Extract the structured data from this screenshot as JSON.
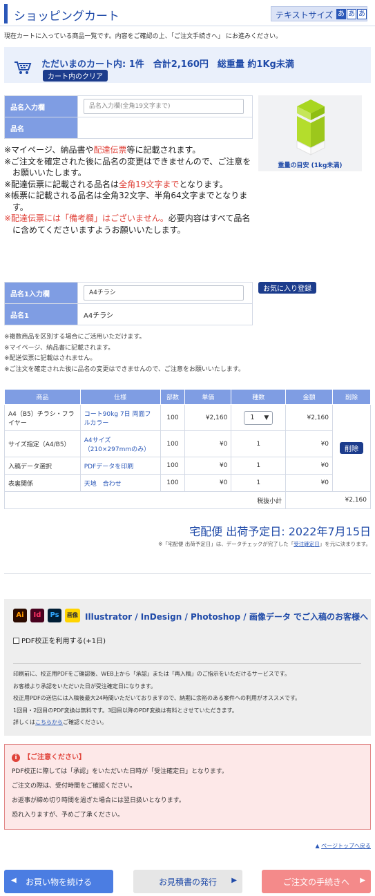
{
  "header": {
    "title": "ショッピングカート",
    "text_size_label": "テキストサイズ",
    "sizes": [
      "あ",
      "あ",
      "あ"
    ]
  },
  "intro": "現在カートに入っている商品一覧です。内容をご確認の上、「ご注文手続きへ」 にお進みください。",
  "cart_summary": {
    "text": "ただいまのカート内: 1件　合計2,160円　総重量 約1Kg未満",
    "clear_button": "カート内のクリア",
    "icon": "cart-icon"
  },
  "name_form": {
    "input_label": "品名入力欄",
    "input_placeholder": "品名入力欄(全角19文字まで)",
    "name_label": "品名",
    "name_value": ""
  },
  "weight": {
    "label": "重量の目安 (1kg未満)",
    "icon": "box-icon"
  },
  "notes1": {
    "l1a": "※マイページ、納品書や",
    "l1b": "配達伝票",
    "l1c": "等に記載されます。",
    "l2": "※ご注文を確定された後に品名の変更はできませんので、ご注意をお願いいたします。",
    "l3a": "※配達伝票に記載される品名は",
    "l3b": "全角19文字まで",
    "l3c": "となります。",
    "l4": "※帳票に記載される品名は全角32文字、半角64文字までとなります。",
    "l5a": "※配達伝票には「備考欄」はございません。",
    "l5b": "必要内容はすべて品名に含めてくださいますようお願いいたします。"
  },
  "item_form": {
    "input_label": "品名1入力欄",
    "input_value": "A4チラシ",
    "name_label": "品名1",
    "name_value": "A4チラシ",
    "favorite_button": "お気に入り登録"
  },
  "notes2": [
    "※複数商品を区別する場合にご活用いただけます。",
    "※マイページ、納品書に記載されます。",
    "※配送伝票に記載はされません。",
    "※ご注文を確定された後に品名の変更はできませんので、ご注意をお願いいたします。"
  ],
  "cart_table": {
    "headers": [
      "商品",
      "仕様",
      "部数",
      "単価",
      "種数",
      "金額",
      "削除"
    ],
    "rows": [
      {
        "product": "A4（B5）チラシ・フライヤー",
        "spec": "コート90kg 7日 両面フルカラー",
        "qty": "100",
        "unit": "¥2,160",
        "kinds": "1",
        "amount": "¥2,160"
      },
      {
        "product": "サイズ指定（A4/B5）",
        "spec": "A4サイズ（210×297mmのみ）",
        "qty": "100",
        "unit": "¥0",
        "kinds": "1",
        "amount": "¥0"
      },
      {
        "product": "入稿データ選択",
        "spec": "PDFデータを印刷",
        "qty": "100",
        "unit": "¥0",
        "kinds": "1",
        "amount": "¥0"
      },
      {
        "product": "表裏関係",
        "spec": "天地　合わせ",
        "qty": "100",
        "unit": "¥0",
        "kinds": "1",
        "amount": "¥0"
      }
    ],
    "delete_button": "削除",
    "subtotal_label": "税抜小計",
    "subtotal_value": "¥2,160"
  },
  "shipping": {
    "text": "宅配便 出荷予定日: 2022年7月15日",
    "note_a": "※「宅配便 出荷予定日」は、データチェックが完了した「",
    "note_link": "受注確定日",
    "note_b": "」を元に決まります。"
  },
  "pdf_section": {
    "app_icons": [
      {
        "name": "illustrator-icon",
        "text": "Ai",
        "bg": "#2b0b00",
        "fg": "#ff9a00"
      },
      {
        "name": "indesign-icon",
        "text": "Id",
        "bg": "#49021f",
        "fg": "#ff3366"
      },
      {
        "name": "photoshop-icon",
        "text": "Ps",
        "bg": "#001e36",
        "fg": "#31a8ff"
      },
      {
        "name": "image-icon",
        "text": "画像",
        "bg": "#ffd400",
        "fg": "#333333"
      }
    ],
    "heading": "Illustrator / InDesign / Photoshop / 画像データ でご入稿のお客様へ",
    "checkbox_label": "PDF校正を利用する(+1日)",
    "desc": [
      "印刷前に、校正用PDFをご确認後、WEB上から「承認」または「再入稿」のご指示をいただけるサービスです。",
      "お客様より承認をいただいた日が受注確定日になります。",
      "校正用PDFの送信には入稿後最大24時間いただいておりますので、納期に余裕のある案件への利用がオススメです。",
      "1回目・2回目のPDF変換は無料です。3回目以降のPDF変換は有料とさせていただきます。"
    ],
    "desc_last_a": "詳しくは",
    "desc_last_link": "こちらから",
    "desc_last_b": "ご確認ください。"
  },
  "warning": {
    "title": "【ご注意ください】",
    "lines": [
      "PDF校正に際しては「承認」をいただいた日時が「受注確定日」となります。",
      "ご注文の際は、受付時間をご確認ください。",
      "お返事が締め切り時間を過ぎた場合には翌日扱いとなります。",
      "恐れ入りますが、予めご了承ください。"
    ]
  },
  "page_top": "ページトップへ戻る",
  "buttons": {
    "back": "お買い物を続ける",
    "quote": "お見積書の発行",
    "order": "ご注文の手続きへ"
  }
}
